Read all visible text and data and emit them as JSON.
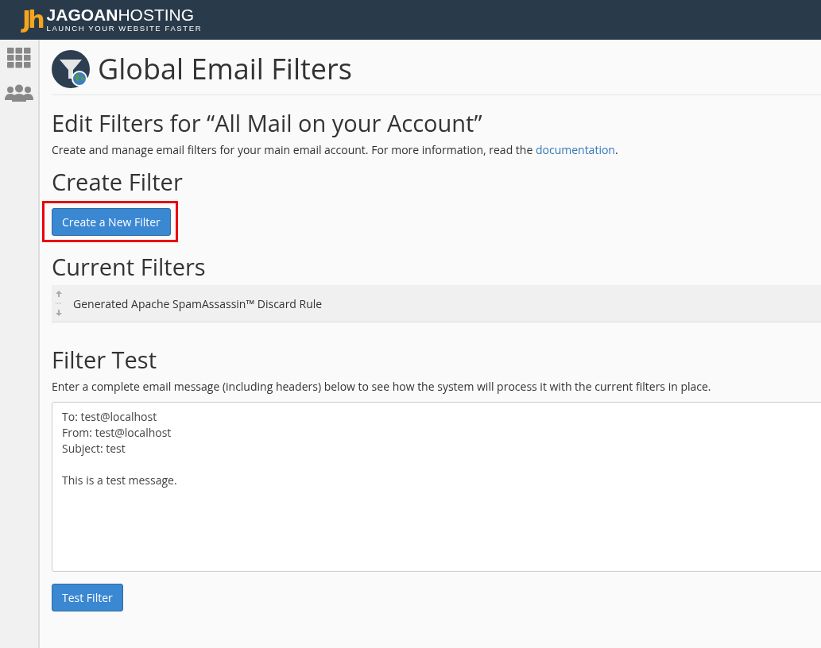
{
  "header": {
    "logo_mark": "Jh",
    "brand": "**JAGOAN**HOSTING",
    "tagline": "LAUNCH YOUR WEBSITE FASTER"
  },
  "page": {
    "title": "Global Email Filters"
  },
  "edit_section": {
    "heading": "Edit Filters for “All Mail on your Account”",
    "description": "Create and manage email filters for your main email account. For more information, read the ",
    "link": "documentation",
    "after_link": "."
  },
  "create_section": {
    "heading": "Create Filter",
    "button": "Create a New Filter",
    "highlighted": true
  },
  "current_filters": {
    "heading": "Current Filters",
    "items": [
      {
        "name": "Generated Apache SpamAssassin™ Discard Rule"
      }
    ]
  },
  "filter_test": {
    "heading": "Filter Test",
    "description": "Enter a complete email message (including headers) below to see how the system will process it with the current filters in place.",
    "message": "To: test@localhost\nFrom: test@localhost\nSubject: test\n\nThis is a test message.",
    "button": "Test Filter"
  }
}
